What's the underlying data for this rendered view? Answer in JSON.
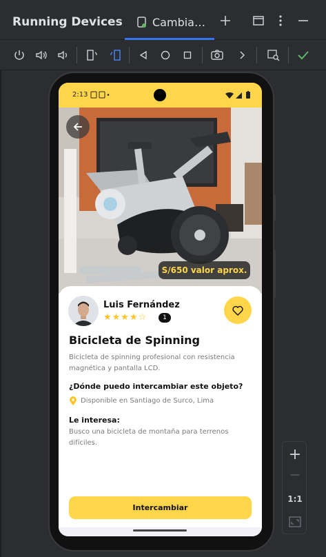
{
  "ide": {
    "panel_title": "Running Devices",
    "tab_label": "Cambia…",
    "add_tab_icon": "plus-icon",
    "window_icon": "maximize-icon",
    "more_icon": "more-vertical-icon",
    "minimize_icon": "minimize-icon"
  },
  "toolbar": {
    "icons": [
      "power-icon",
      "volume-up-icon",
      "volume-down-icon",
      "rotate-left-icon",
      "rotate-right-icon",
      "back-icon",
      "home-icon",
      "overview-icon",
      "screenshot-icon",
      "more-chevron-icon",
      "layout-inspector-icon",
      "check-icon"
    ]
  },
  "zoom": {
    "zoom_in": "+",
    "zoom_out": "—",
    "actual_size": "1:1",
    "fit_icon": "fit-screen-icon"
  },
  "device": {
    "status_time": "2:13",
    "price_badge": "S/650 valor aprox.",
    "owner_name": "Luis Fernández",
    "rating": 4,
    "rating_max": 5,
    "stars_text": "★★★★☆",
    "review_count": "1",
    "item_title": "Bicicleta de Spinning",
    "item_description": "Bicicleta de spinning profesional con resistencia magnética y pantalla LCD.",
    "where_title": "¿Dónde puedo intercambiar este objeto?",
    "location": "Disponible en Santiago de Surco, Lima",
    "interest_title": "Le interesa:",
    "interest_description": "Busco una bicicleta de montaña para terrenos difíciles.",
    "exchange_button": "Intercambiar"
  },
  "colors": {
    "accent": "#ffd54a",
    "ide_bg": "#2b2d30",
    "tab_underline": "#3574f0",
    "check_green": "#5fb865"
  }
}
